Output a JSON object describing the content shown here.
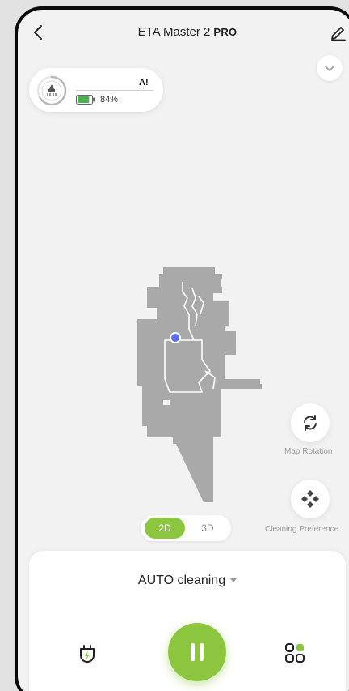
{
  "header": {
    "title": "ETA Master 2",
    "title_suffix": "PRO",
    "back_icon": "chevron-left-icon",
    "edit_icon": "pencil-icon",
    "collapse_icon": "chevron-down-icon"
  },
  "status": {
    "mode_text": "A!",
    "battery_text": "84%",
    "battery_level": 0.84,
    "robot_icon": "vacuum-robot-icon",
    "battery_icon": "battery-icon"
  },
  "map": {
    "robot_marker_color": "#5b6cf0"
  },
  "tools": {
    "map_rotation_label": "Map Rotation",
    "map_rotation_icon": "rotate-icon",
    "cleaning_preference_label": "Cleaning Preference",
    "cleaning_preference_icon": "diamond-grid-icon"
  },
  "view_toggle": {
    "option_2d": "2D",
    "option_3d": "3D",
    "selected": "2D"
  },
  "controls": {
    "cleaning_mode": "AUTO cleaning",
    "dock_icon": "charging-dock-icon",
    "pause_icon": "pause-icon",
    "rooms_icon": "room-grid-icon"
  },
  "colors": {
    "accent": "#8cc63f",
    "background": "#f2f2f2",
    "bezel": "#0a0a0a"
  }
}
